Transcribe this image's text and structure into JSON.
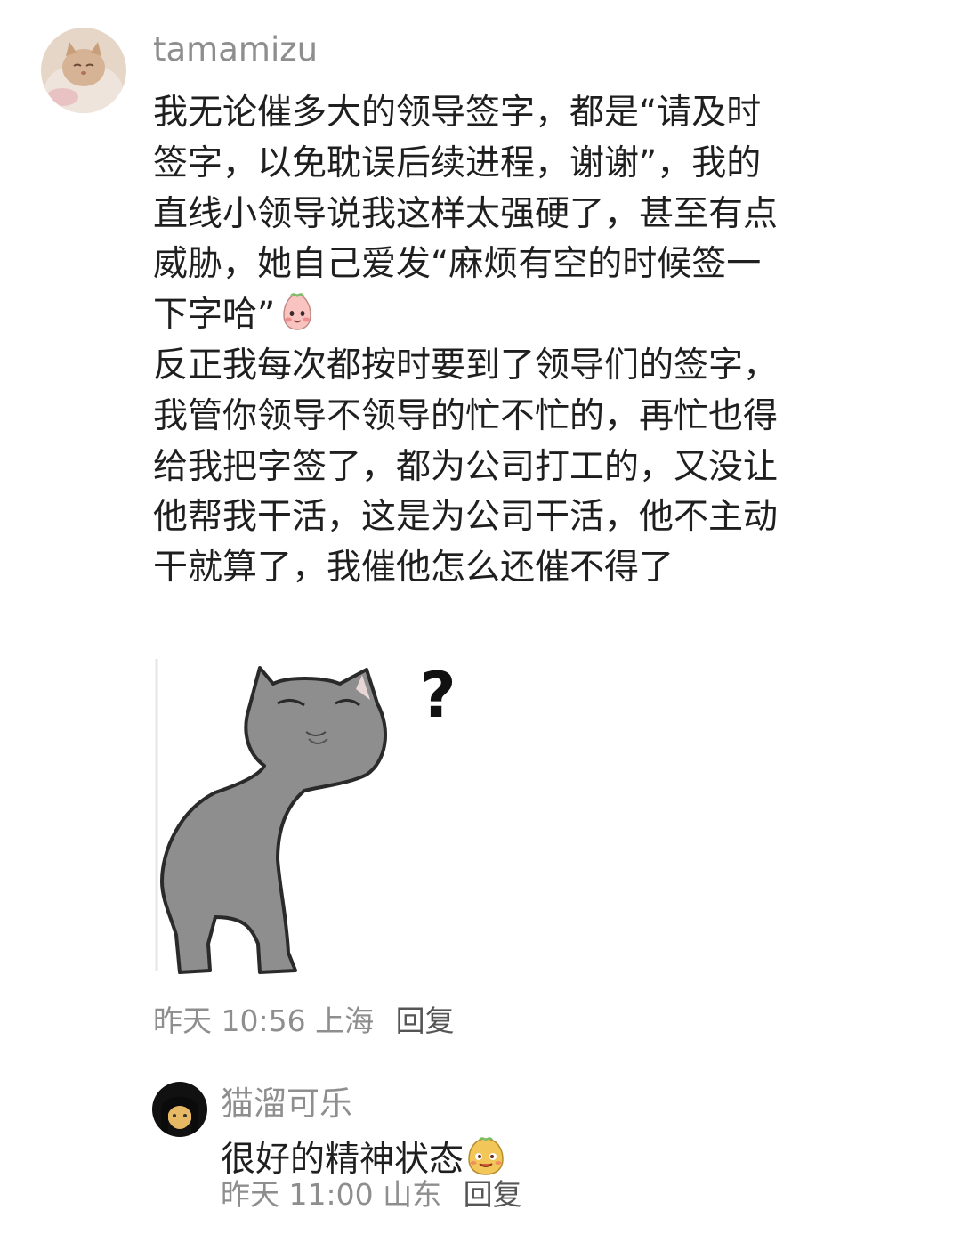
{
  "main_comment": {
    "username": "tamamizu",
    "text_part1": "我无论催多大的领导签字，都是“请及时签字，以免耽误后续进程，谢谢”，我的直线小领导说我这样太强硬了，甚至有点威胁，她自己爱发“麻烦有空的时候签一下字哈”",
    "emoji_1": "shy-peach-emoji",
    "text_part2": "反正我每次都按时要到了领导们的签字，我管你领导不领导的忙不忙的，再忙也得给我把字签了，都为公司打工的，又没让他帮我干活，这是为公司干活，他不主动干就算了，我催他怎么还催不得了",
    "sticker": "confused-gray-cat-sticker",
    "sticker_text": "?",
    "time": "昨天 10:56",
    "location": "上海",
    "reply_label": "回复"
  },
  "reply_comment": {
    "username": "猫溜可乐",
    "text": "很好的精神状态",
    "emoji": "smug-face-emoji",
    "time": "昨天 11:00",
    "location": "山东",
    "reply_label": "回复"
  },
  "colors": {
    "username": "#8e8e8e",
    "text": "#1f1f1f",
    "meta": "#8e8e8e",
    "reply": "#555555"
  }
}
